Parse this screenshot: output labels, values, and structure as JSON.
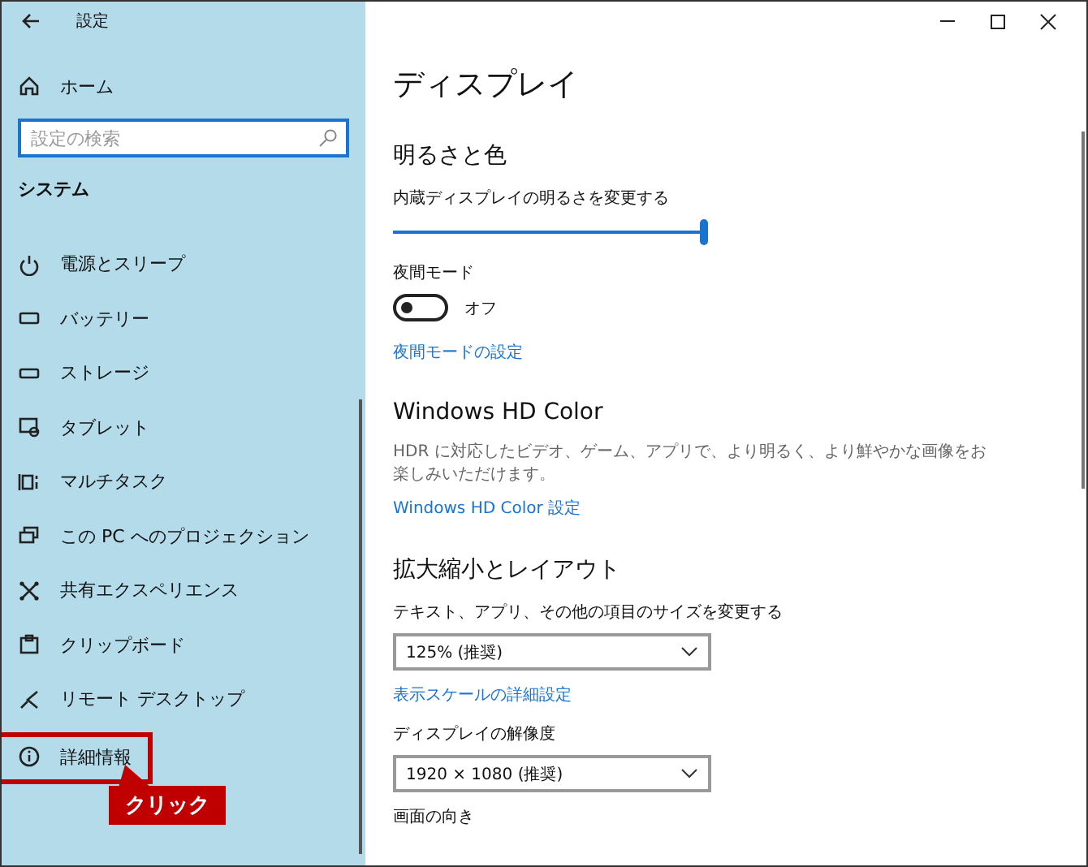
{
  "window": {
    "title": "設定"
  },
  "sidebar": {
    "home": "ホーム",
    "search": {
      "placeholder": "設定の検索"
    },
    "section": "システム",
    "items": [
      {
        "label": "電源とスリープ",
        "highlighted": false
      },
      {
        "label": "バッテリー",
        "highlighted": false
      },
      {
        "label": "ストレージ",
        "highlighted": false
      },
      {
        "label": "タブレット",
        "highlighted": false
      },
      {
        "label": "マルチタスク",
        "highlighted": false
      },
      {
        "label": "この PC へのプロジェクション",
        "highlighted": false
      },
      {
        "label": "共有エクスペリエンス",
        "highlighted": false
      },
      {
        "label": "クリップボード",
        "highlighted": false
      },
      {
        "label": "リモート デスクトップ",
        "highlighted": false
      },
      {
        "label": "詳細情報",
        "highlighted": true
      }
    ],
    "callout": "クリック"
  },
  "page": {
    "title": "ディスプレイ",
    "sections": [
      {
        "heading": "明るさと色",
        "rows": [
          {
            "kind": "slider",
            "label": "内蔵ディスプレイの明るさを変更する",
            "level": 1
          },
          {
            "kind": "toggle",
            "label": "夜間モード",
            "on": false,
            "state_text": "オフ"
          },
          {
            "kind": "link",
            "text": "夜間モードの設定"
          }
        ]
      },
      {
        "heading": "Windows HD Color",
        "rows": [
          {
            "kind": "text",
            "text": "HDR に対応したビデオ、ゲーム、アプリで、より明るく、より鮮やかな画像をお楽しみいただけます。"
          },
          {
            "kind": "link",
            "text": "Windows HD Color 設定"
          }
        ]
      },
      {
        "heading": "拡大縮小とレイアウト",
        "rows": [
          {
            "kind": "dropdown",
            "label": "テキスト、アプリ、その他の項目のサイズを変更する",
            "value": "125% (推奨)"
          },
          {
            "kind": "link",
            "text": "表示スケールの詳細設定"
          },
          {
            "kind": "dropdown",
            "label": "ディスプレイの解像度",
            "value": "1920 × 1080 (推奨)"
          },
          {
            "kind": "label",
            "text": "画面の向き"
          }
        ]
      }
    ]
  }
}
